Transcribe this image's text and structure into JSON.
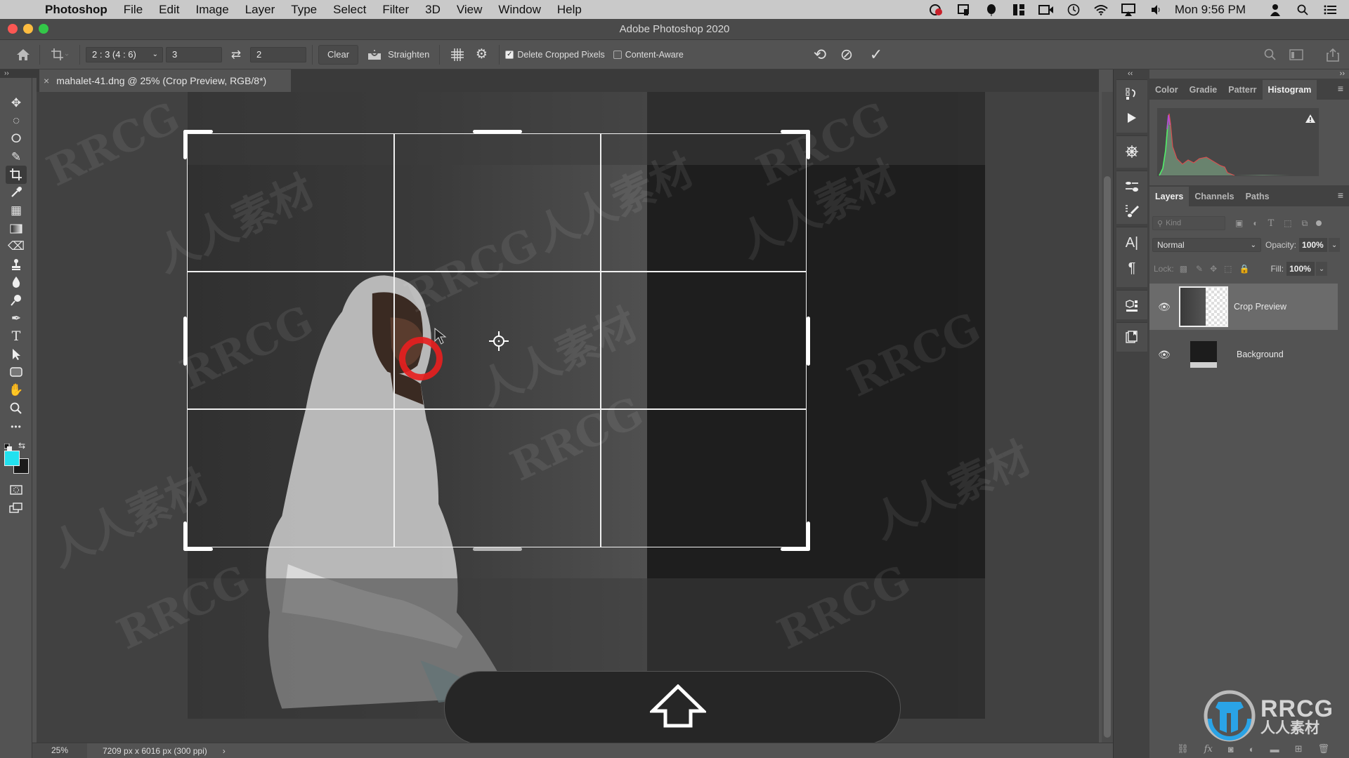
{
  "menubar": {
    "app_name": "Photoshop",
    "items": [
      "File",
      "Edit",
      "Image",
      "Layer",
      "Type",
      "Select",
      "Filter",
      "3D",
      "View",
      "Window",
      "Help"
    ],
    "status_icons": [
      "creative-cloud-icon",
      "display-icon",
      "balloon-icon",
      "grid-app-icon",
      "camera-icon",
      "time-machine-icon",
      "wifi-icon",
      "airplay-icon",
      "volume-icon"
    ],
    "clock": "Mon 9:56 PM"
  },
  "window": {
    "title": "Adobe Photoshop 2020"
  },
  "options_bar": {
    "ratio_preset": "2 : 3 (4 : 6)",
    "width_value": "3",
    "height_value": "2",
    "clear_label": "Clear",
    "straighten_label": "Straighten",
    "delete_cropped_label": "Delete Cropped Pixels",
    "delete_cropped_checked": true,
    "content_aware_label": "Content-Aware",
    "content_aware_checked": false
  },
  "document": {
    "tab_label": "mahalet-41.dng @ 25% (Crop Preview, RGB/8*)"
  },
  "tools": [
    {
      "name": "move",
      "glyph": "✥"
    },
    {
      "name": "elliptical-marquee",
      "glyph": "◌"
    },
    {
      "name": "lasso",
      "glyph": "ⵔ"
    },
    {
      "name": "quick-selection",
      "glyph": "✎"
    },
    {
      "name": "crop",
      "glyph": "⌗",
      "active": true
    },
    {
      "name": "eyedropper",
      "glyph": "⁄"
    },
    {
      "name": "patch",
      "glyph": "▦"
    },
    {
      "name": "gradient",
      "glyph": "▭"
    },
    {
      "name": "eraser",
      "glyph": "⌫"
    },
    {
      "name": "clone-stamp",
      "glyph": "⊥"
    },
    {
      "name": "blur",
      "glyph": "💧"
    },
    {
      "name": "dodge",
      "glyph": "⚲"
    },
    {
      "name": "pen",
      "glyph": "✒"
    },
    {
      "name": "type",
      "glyph": "T"
    },
    {
      "name": "path-selection",
      "glyph": "➤"
    },
    {
      "name": "rectangle",
      "glyph": "▢"
    },
    {
      "name": "hand",
      "glyph": "✋"
    },
    {
      "name": "zoom",
      "glyph": "🔍"
    },
    {
      "name": "more-tools",
      "glyph": "•••"
    }
  ],
  "colors": {
    "foreground": "#22e1ef",
    "background": "#1a1a1a",
    "red_marker": "#e62020"
  },
  "status": {
    "zoom": "25%",
    "dimensions": "7209 px x 6016 px (300 ppi)",
    "more": "›"
  },
  "panels": {
    "top_tabs": [
      "Color",
      "Gradie",
      "Patterr",
      "Histogram"
    ],
    "top_active": "Histogram",
    "layer_tabs": [
      "Layers",
      "Channels",
      "Paths"
    ],
    "layer_active": "Layers",
    "filter_placeholder": "Kind",
    "blend_mode": "Normal",
    "opacity_label": "Opacity:",
    "opacity_value": "100%",
    "lock_label": "Lock:",
    "fill_label": "Fill:",
    "fill_value": "100%",
    "layers": [
      {
        "name": "Crop Preview",
        "visible": true,
        "selected": true
      },
      {
        "name": "Background",
        "visible": true,
        "selected": false
      }
    ]
  },
  "watermark": {
    "brand": "RRCG",
    "brand_cn": "人人素材"
  }
}
